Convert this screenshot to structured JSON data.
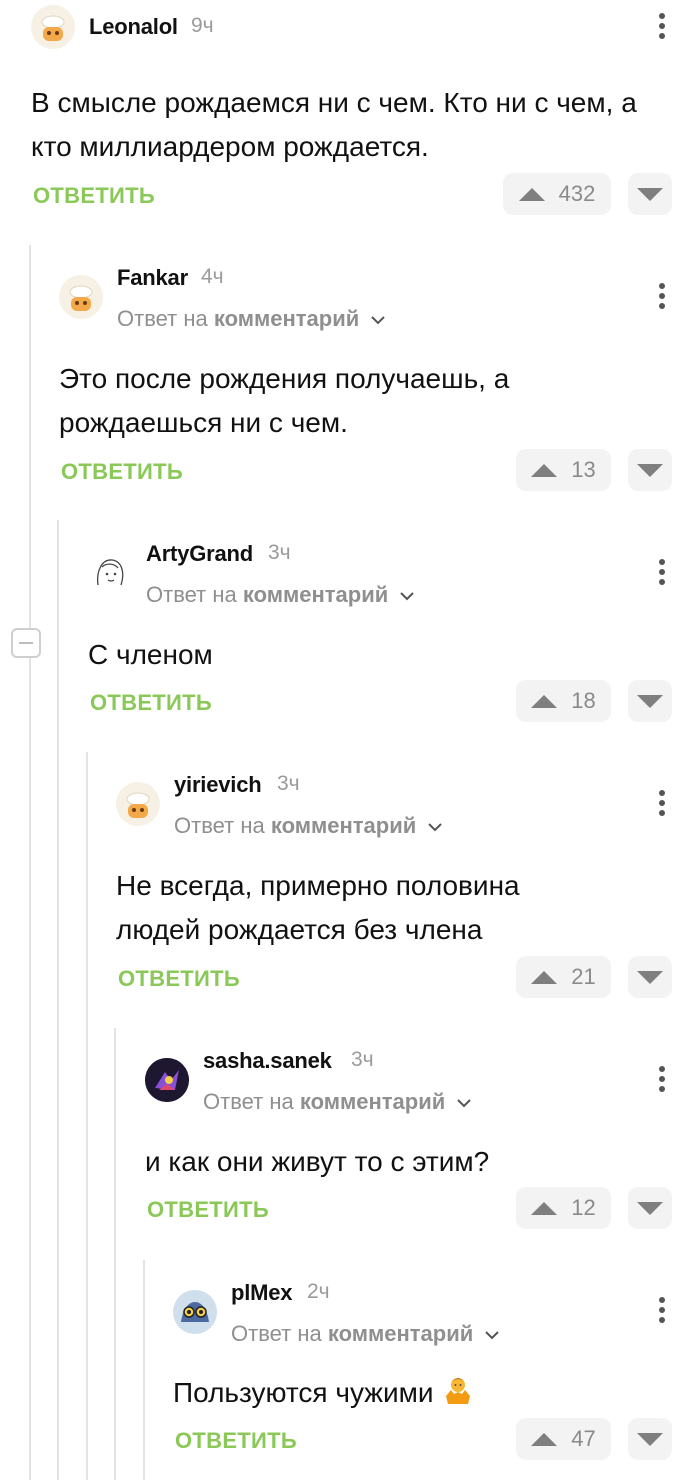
{
  "ui": {
    "reply_label": "ОТВЕТИТЬ",
    "reply_to_prefix": "Ответ на",
    "reply_to_link": "комментарий"
  },
  "comments": [
    {
      "author": "Leonalol",
      "time": "9ч",
      "is_reply": false,
      "text": "В смысле рождаемся ни с чем. Кто ни с чем, а кто миллиардером рождается.",
      "rating": "432"
    },
    {
      "author": "Fankar",
      "time": "4ч",
      "is_reply": true,
      "text": "Это после рождения получаешь, а рождаешься ни с чем.",
      "rating": "13"
    },
    {
      "author": "ArtyGrand",
      "time": "3ч",
      "is_reply": true,
      "text": "С членом",
      "rating": "18"
    },
    {
      "author": "yirievich",
      "time": "3ч",
      "is_reply": true,
      "text": "Не всегда, примерно половина людей рождается без члена",
      "rating": "21"
    },
    {
      "author": "sasha.sanek",
      "time": "3ч",
      "is_reply": true,
      "text": "и как они живут то с этим?",
      "rating": "12"
    },
    {
      "author": "plMex",
      "time": "2ч",
      "is_reply": true,
      "text": "Пользуются чужими",
      "emoji": "shrug-person-emoji",
      "rating": "47"
    }
  ],
  "colors": {
    "accent_green": "#8ac858",
    "muted_text": "#8f8f8f",
    "thread_line": "#e3e3e3",
    "vote_bg": "#f3f3f3"
  },
  "icons": [
    "more-vertical-icon",
    "chevron-down-icon",
    "upvote-arrow-icon",
    "downvote-arrow-icon",
    "collapse-minus-icon"
  ]
}
